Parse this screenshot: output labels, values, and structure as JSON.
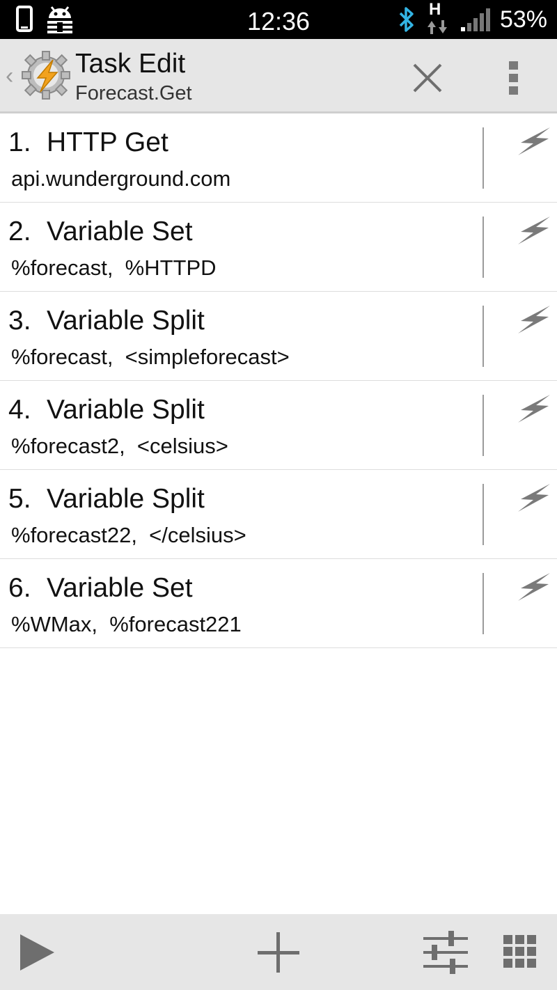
{
  "status_bar": {
    "time": "12:36",
    "battery": "53%",
    "network_type": "H",
    "icons": [
      "phone-icon",
      "android-debug-icon",
      "bluetooth-icon",
      "data-transfer-icon",
      "signal-icon"
    ]
  },
  "action_bar": {
    "title": "Task Edit",
    "subtitle": "Forecast.Get",
    "icons": [
      "back-chevron-icon",
      "tasker-app-icon",
      "close-icon",
      "overflow-menu-icon"
    ]
  },
  "actions": [
    {
      "number": "1.",
      "name": "HTTP Get",
      "detail": "api.wunderground.com"
    },
    {
      "number": "2.",
      "name": "Variable Set",
      "detail": "%forecast,  %HTTPD"
    },
    {
      "number": "3.",
      "name": "Variable Split",
      "detail": "%forecast,  <simpleforecast>"
    },
    {
      "number": "4.",
      "name": "Variable Split",
      "detail": "%forecast2,  <celsius>"
    },
    {
      "number": "5.",
      "name": "Variable Split",
      "detail": "%forecast22,  </celsius>"
    },
    {
      "number": "6.",
      "name": "Variable Set",
      "detail": "%WMax,  %forecast221"
    }
  ],
  "bottom_bar": {
    "icons": [
      "play-icon",
      "add-icon",
      "sliders-icon",
      "grid-icon"
    ]
  },
  "colors": {
    "status_bar_bg": "#000000",
    "action_bar_bg": "#e6e6e6",
    "bottom_bar_bg": "#e6e6e6",
    "icon_gray": "#6e6e6e",
    "bluetooth": "#33b5e5",
    "bolt_accent": "#f2a21e"
  }
}
